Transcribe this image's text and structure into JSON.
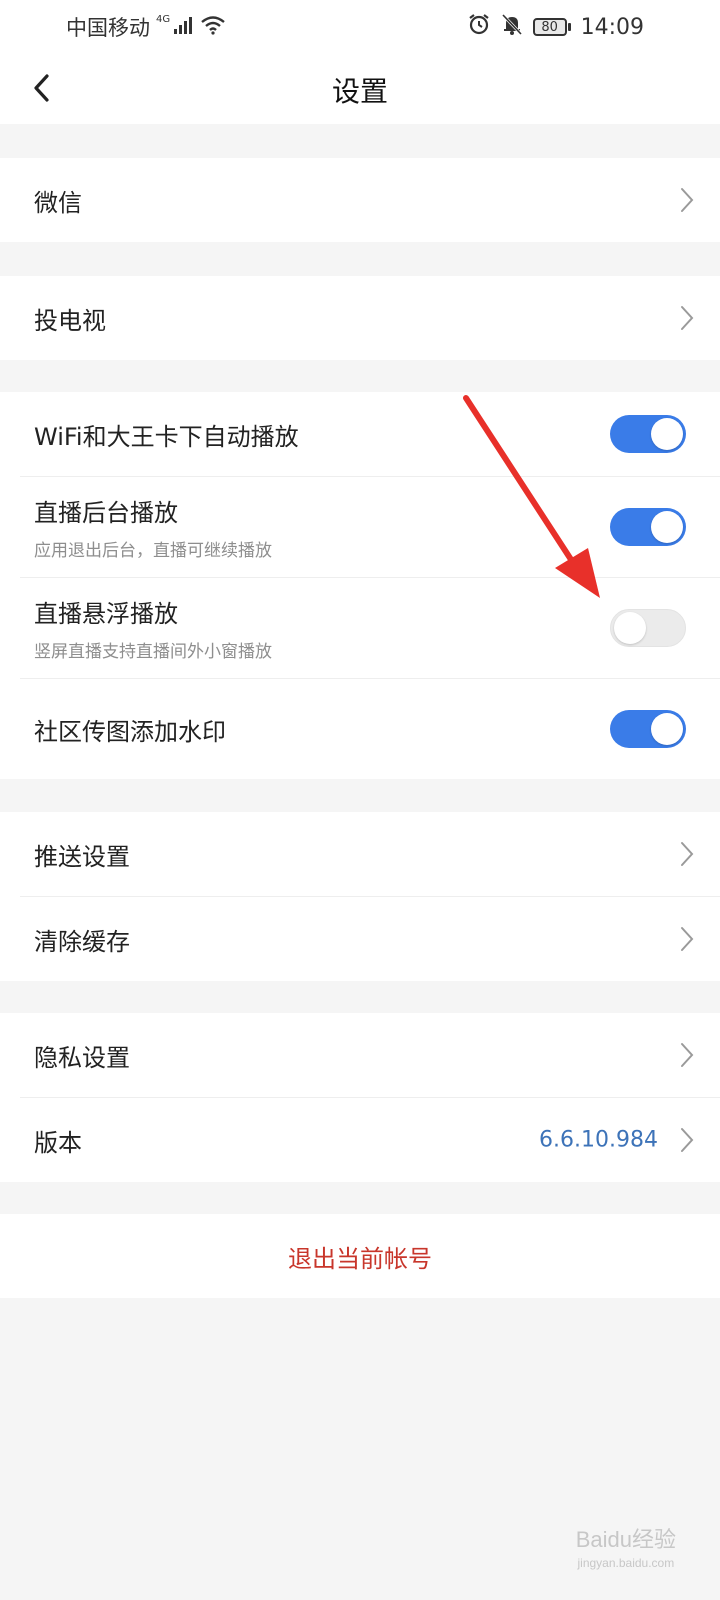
{
  "status_bar": {
    "carrier": "中国移动",
    "network": "4G",
    "battery": "80",
    "time": "14:09"
  },
  "nav": {
    "title": "设置"
  },
  "groups": [
    {
      "items": [
        {
          "label": "微信"
        }
      ]
    },
    {
      "items": [
        {
          "label": "投电视"
        }
      ]
    },
    {
      "items": [
        {
          "label": "WiFi和大王卡下自动播放",
          "toggle": true
        },
        {
          "label": "直播后台播放",
          "subtitle": "应用退出后台，直播可继续播放",
          "toggle": true
        },
        {
          "label": "直播悬浮播放",
          "subtitle": "竖屏直播支持直播间外小窗播放",
          "toggle": false
        },
        {
          "label": "社区传图添加水印",
          "toggle": true
        }
      ]
    },
    {
      "items": [
        {
          "label": "推送设置"
        },
        {
          "label": "清除缓存"
        }
      ]
    },
    {
      "items": [
        {
          "label": "隐私设置"
        },
        {
          "label": "版本",
          "value": "6.6.10.984"
        }
      ]
    }
  ],
  "logout_label": "退出当前帐号",
  "watermark": {
    "main": "Baidu经验",
    "url": "jingyan.baidu.com"
  },
  "colors": {
    "toggle_on": "#3a7ce8",
    "logout_text": "#c8362b",
    "version_text": "#3d73b8",
    "annotation_arrow": "#e8302a"
  },
  "icons": [
    "back-arrow-icon",
    "chevron-right-icon",
    "signal-icon",
    "wifi-icon",
    "alarm-icon",
    "bell-off-icon",
    "battery-icon"
  ]
}
